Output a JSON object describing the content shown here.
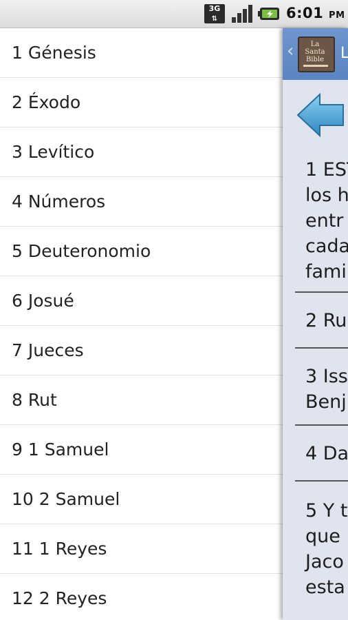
{
  "status_bar": {
    "network": "3G",
    "time": "6:01",
    "ampm": "PM"
  },
  "books": [
    {
      "label": "1 Génesis"
    },
    {
      "label": "2 Éxodo"
    },
    {
      "label": "3 Levítico"
    },
    {
      "label": "4 Números"
    },
    {
      "label": "5 Deuteronomio"
    },
    {
      "label": "6 Josué"
    },
    {
      "label": "7 Jueces"
    },
    {
      "label": "8 Rut"
    },
    {
      "label": "9 1 Samuel"
    },
    {
      "label": "10 2 Samuel"
    },
    {
      "label": "11 1 Reyes"
    },
    {
      "label": "12 2 Reyes"
    }
  ],
  "panel": {
    "header": {
      "icon_text": "La Santa Bible",
      "title": "L"
    },
    "verses": [
      {
        "lines": [
          "1 EST",
          "los h",
          "entr",
          "cada",
          "fami"
        ]
      },
      {
        "lines": [
          "2 Ru"
        ]
      },
      {
        "lines": [
          "3 Iss",
          "Benj"
        ]
      },
      {
        "lines": [
          "4 Da"
        ]
      },
      {
        "lines": [
          "5 Y t",
          "que",
          "Jaco",
          "esta"
        ]
      }
    ]
  },
  "colors": {
    "header_blue": "#5f89c6",
    "panel_bg": "#dfe4ef",
    "arrow_blue": "#3f9ad3"
  }
}
